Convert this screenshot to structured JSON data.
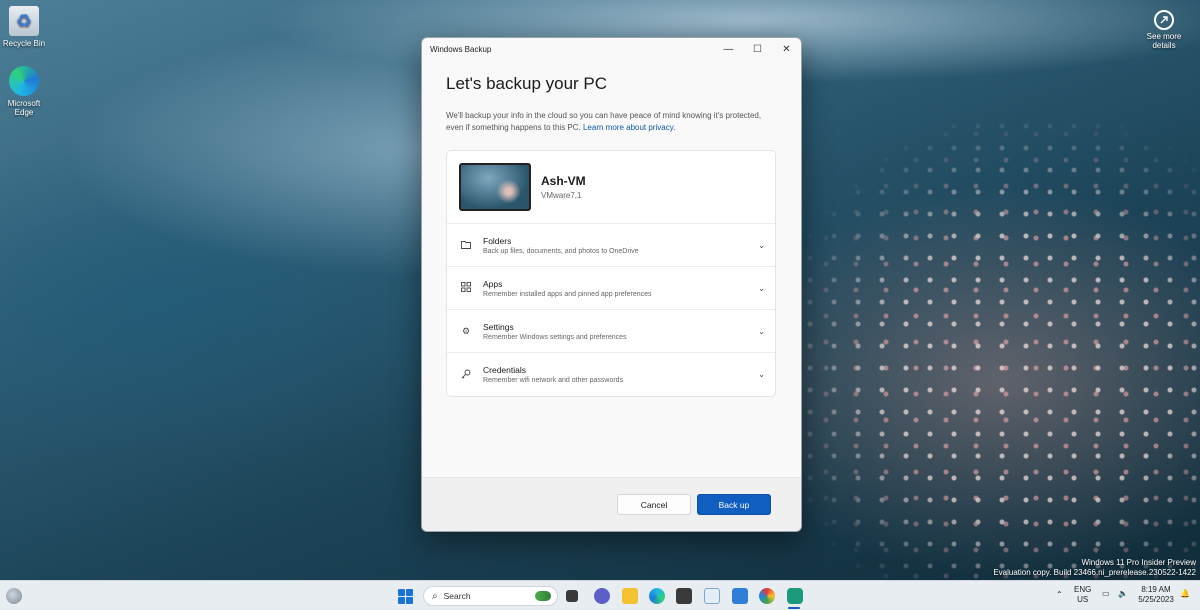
{
  "desktop": {
    "icons": [
      {
        "label": "Recycle Bin"
      },
      {
        "label": "Microsoft Edge"
      }
    ],
    "see_more_label": "See more details",
    "watermark": {
      "line1": "Windows 11 Pro Insider Preview",
      "line2": "Evaluation copy. Build 23466.ni_prerelease.230522-1422"
    }
  },
  "window": {
    "title": "Windows Backup",
    "controls": {
      "minimize": "—",
      "maximize": "☐",
      "close": "✕"
    },
    "heading": "Let's backup your PC",
    "description": "We'll backup your info in the cloud so you can have peace of mind knowing it's protected, even if something happens to this PC.",
    "privacy_link": "Learn more about privacy.",
    "device": {
      "name": "Ash-VM",
      "model": "VMware7,1"
    },
    "sections": [
      {
        "icon": "folder-icon",
        "title": "Folders",
        "subtitle": "Back up files, documents, and photos to OneDrive"
      },
      {
        "icon": "apps-icon",
        "title": "Apps",
        "subtitle": "Remember installed apps and pinned app preferences"
      },
      {
        "icon": "gear-icon",
        "title": "Settings",
        "subtitle": "Remember Windows settings and preferences"
      },
      {
        "icon": "key-icon",
        "title": "Credentials",
        "subtitle": "Remember wifi network and other passwords"
      }
    ],
    "buttons": {
      "cancel": "Cancel",
      "backup": "Back up"
    },
    "accent_color": "#0f5ec0"
  },
  "taskbar": {
    "search_placeholder": "Search",
    "language": {
      "line1": "ENG",
      "line2": "US"
    },
    "time": "8:19 AM",
    "date": "5/25/2023"
  }
}
